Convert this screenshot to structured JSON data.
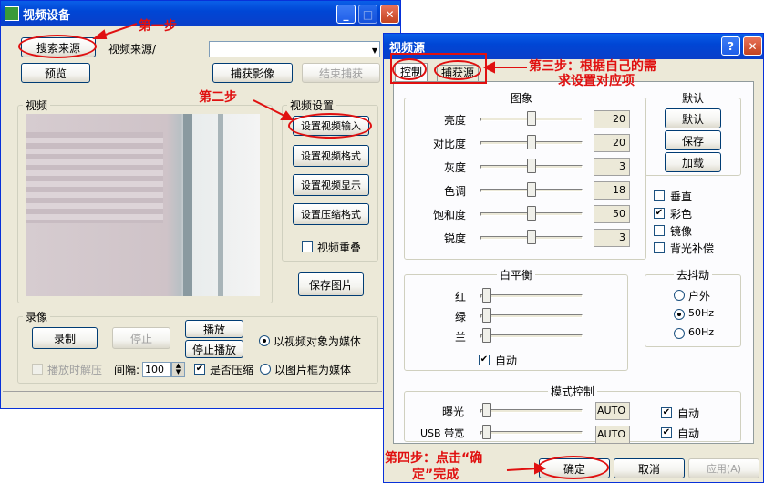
{
  "left_window": {
    "title": "视频设备",
    "search_source_button": "搜索来源",
    "video_source_label": "视频来源/",
    "preview_button": "预览",
    "capture_button": "捕获影像",
    "end_capture_button": "结束捕获",
    "video_group_label": "视频",
    "video_settings_group_label": "视频设置",
    "set_video_input_button": "设置视频输入",
    "set_video_format_button": "设置视频格式",
    "set_video_display_button": "设置视频显示",
    "set_compression_button": "设置压缩格式",
    "video_overlay_label": "视频重叠",
    "save_image_button": "保存图片",
    "record_group_label": "录像",
    "record_button": "录制",
    "stop_button": "停止",
    "play_button": "播放",
    "stop_play_button": "停止播放",
    "decompress_label": "播放时解压",
    "interval_label": "间隔:",
    "interval_value": "100",
    "compress_label": "是否压缩",
    "media_video_label": "以视频对象为媒体",
    "media_frame_label": "以图片框为媒体"
  },
  "right_window": {
    "title": "视频源",
    "help_label": "?",
    "tab_control": "控制",
    "tab_capture": "捕获源",
    "image_group_label": "图象",
    "sliders": [
      {
        "label": "亮度",
        "value": "20",
        "fraction": 0.5
      },
      {
        "label": "对比度",
        "value": "20",
        "fraction": 0.5
      },
      {
        "label": "灰度",
        "value": "3",
        "fraction": 0.5
      },
      {
        "label": "色调",
        "value": "18",
        "fraction": 0.5
      },
      {
        "label": "饱和度",
        "value": "50",
        "fraction": 0.5
      },
      {
        "label": "锐度",
        "value": "3",
        "fraction": 0.5
      }
    ],
    "default_group_label": "默认",
    "default_button": "默认",
    "save_button": "保存",
    "load_button": "加载",
    "checks": [
      {
        "label": "垂直",
        "checked": false
      },
      {
        "label": "彩色",
        "checked": true
      },
      {
        "label": "镜像",
        "checked": false
      },
      {
        "label": "背光补偿",
        "checked": false
      }
    ],
    "wb_group_label": "白平衡",
    "wb": [
      {
        "label": "红"
      },
      {
        "label": "绿"
      },
      {
        "label": "兰"
      }
    ],
    "wb_auto_label": "自动",
    "flicker_group_label": "去抖动",
    "flicker_options": [
      "户外",
      "50Hz",
      "60Hz"
    ],
    "mode_group_label": "模式控制",
    "exposure_label": "曝光",
    "exposure_value": "AUTO",
    "usb_label": "USB 带宽",
    "usb_value": "AUTO",
    "exposure_auto_label": "自动",
    "usb_auto_label": "自动",
    "ok_button": "确定",
    "cancel_button": "取消",
    "apply_button": "应用(A)"
  },
  "annotations": {
    "step1": "第一步",
    "step2": "第二步",
    "step3_line1": "第三步：根据自己的需",
    "step3_line2": "求设置对应项",
    "step4_line1": "第四步：点击“确",
    "step4_line2": "定”完成"
  },
  "colors": {
    "titlebar": "#0a3fc9",
    "annotation": "#e01010",
    "window_bg": "#ece9d8"
  }
}
